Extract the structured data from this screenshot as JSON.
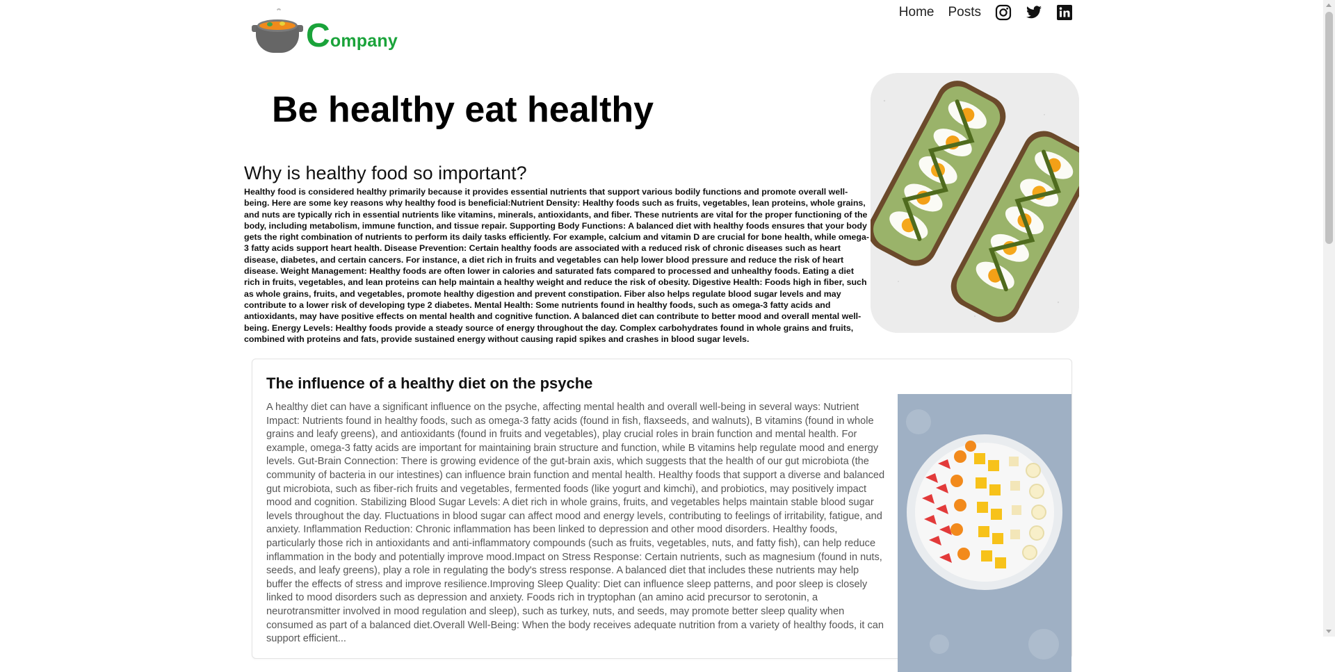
{
  "header": {
    "brand": {
      "initial": "C",
      "rest": "ompany"
    },
    "nav": {
      "home": "Home",
      "posts": "Posts"
    },
    "social_icons": [
      "instagram-icon",
      "twitter-icon",
      "linkedin-icon"
    ]
  },
  "hero": {
    "title": "Be healthy eat healthy",
    "subtitle": "Why is healthy food so important?",
    "body": "Healthy food is considered healthy primarily because it provides essential nutrients that support various bodily functions and promote overall well-being. Here are some key reasons why healthy food is beneficial:Nutrient Density: Healthy foods such as fruits, vegetables, lean proteins, whole grains, and nuts are typically rich in essential nutrients like vitamins, minerals, antioxidants, and fiber. These nutrients are vital for the proper functioning of the body, including metabolism, immune function, and tissue repair. Supporting Body Functions: A balanced diet with healthy foods ensures that your body gets the right combination of nutrients to perform its daily tasks efficiently. For example, calcium and vitamin D are crucial for bone health, while omega-3 fatty acids support heart health. Disease Prevention: Certain healthy foods are associated with a reduced risk of chronic diseases such as heart disease, diabetes, and certain cancers. For instance, a diet rich in fruits and vegetables can help lower blood pressure and reduce the risk of heart disease. Weight Management: Healthy foods are often lower in calories and saturated fats compared to processed and unhealthy foods. Eating a diet rich in fruits, vegetables, and lean proteins can help maintain a healthy weight and reduce the risk of obesity. Digestive Health: Foods high in fiber, such as whole grains, fruits, and vegetables, promote healthy digestion and prevent constipation. Fiber also helps regulate blood sugar levels and may contribute to a lower risk of developing type 2 diabetes. Mental Health: Some nutrients found in healthy foods, such as omega-3 fatty acids and antioxidants, may have positive effects on mental health and cognitive function. A balanced diet can contribute to better mood and overall mental well-being. Energy Levels: Healthy foods provide a steady source of energy throughout the day. Complex carbohydrates found in whole grains and fruits, combined with proteins and fats, provide sustained energy without causing rapid spikes and crashes in blood sugar levels."
  },
  "card": {
    "title": "The influence of a healthy diet on the psyche",
    "body": "A healthy diet can have a significant influence on the psyche, affecting mental health and overall well-being in several ways: Nutrient Impact: Nutrients found in healthy foods, such as omega-3 fatty acids (found in fish, flaxseeds, and walnuts), B vitamins (found in whole grains and leafy greens), and antioxidants (found in fruits and vegetables), play crucial roles in brain function and mental health. For example, omega-3 fatty acids are important for maintaining brain structure and function, while B vitamins help regulate mood and energy levels. Gut-Brain Connection: There is growing evidence of the gut-brain axis, which suggests that the health of our gut microbiota (the community of bacteria in our intestines) can influence brain function and mental health. Healthy foods that support a diverse and balanced gut microbiota, such as fiber-rich fruits and vegetables, fermented foods (like yogurt and kimchi), and probiotics, may positively impact mood and cognition. Stabilizing Blood Sugar Levels: A diet rich in whole grains, fruits, and vegetables helps maintain stable blood sugar levels throughout the day. Fluctuations in blood sugar can affect mood and energy levels, contributing to feelings of irritability, fatigue, and anxiety. Inflammation Reduction: Chronic inflammation has been linked to depression and other mood disorders. Healthy foods, particularly those rich in antioxidants and anti-inflammatory compounds (such as fruits, vegetables, nuts, and fatty fish), can help reduce inflammation in the body and potentially improve mood.Impact on Stress Response: Certain nutrients, such as magnesium (found in nuts, seeds, and leafy greens), play a role in regulating the body's stress response. A balanced diet that includes these nutrients may help buffer the effects of stress and improve resilience.Improving Sleep Quality: Diet can influence sleep patterns, and poor sleep is closely linked to mood disorders such as depression and anxiety. Foods rich in tryptophan (an amino acid precursor to serotonin, a neurotransmitter involved in mood regulation and sleep), such as turkey, nuts, and seeds, may promote better sleep quality when consumed as part of a balanced diet.Overall Well-Being: When the body receives adequate nutrition from a variety of healthy foods, it can support efficient..."
  },
  "colors": {
    "brand_green": "#1aa33a",
    "text": "#111111",
    "muted_text": "#555555"
  }
}
